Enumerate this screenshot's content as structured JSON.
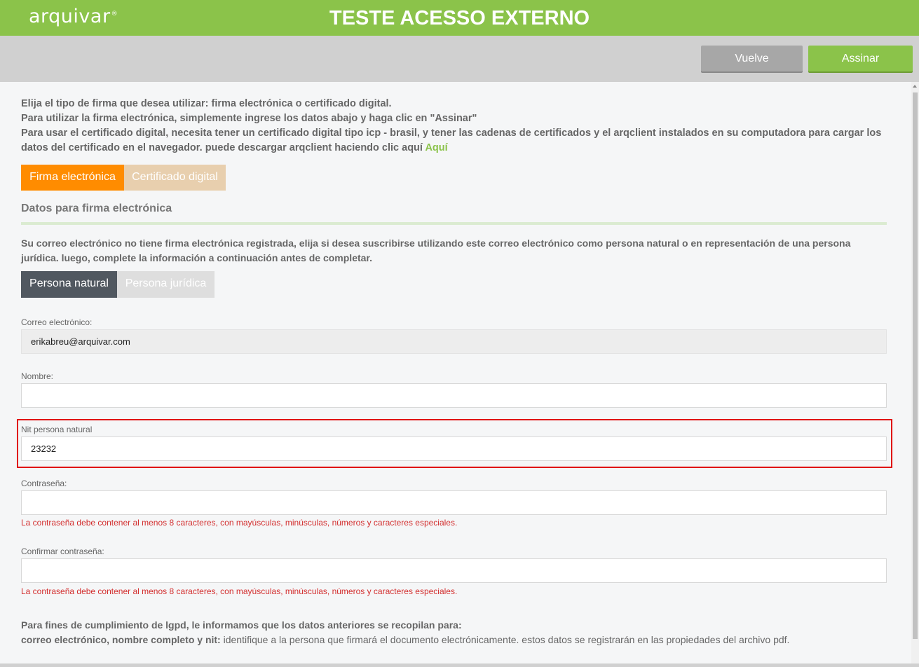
{
  "header": {
    "logo": "arquivar",
    "logo_mark": "®",
    "title": "TESTE ACESSO EXTERNO",
    "brand_color": "#8bc34a"
  },
  "toolbar": {
    "back_label": "Vuelve",
    "sign_label": "Assinar"
  },
  "intro": {
    "line1": "Elija el tipo de firma que desea utilizar: firma electrónica o certificado digital.",
    "line2": "Para utilizar la firma electrónica, simplemente ingrese los datos abajo y haga clic en \"Assinar\"",
    "line3": "Para usar el certificado digital, necesita tener un certificado digital tipo icp - brasil, y tener las cadenas de certificados y el arqclient instalados en su computadora para cargar los datos del certificado en el navegador. puede descargar arqclient haciendo clic aquí",
    "link": "Aquí"
  },
  "signature_tabs": {
    "electronic": "Firma electrónica",
    "certificate": "Certificado digital",
    "active": "electronic"
  },
  "section": {
    "title": "Datos para firma electrónica",
    "notice": "Su correo electrónico no tiene firma electrónica registrada, elija si desea suscribirse utilizando este correo electrónico como persona natural o en representación de una persona jurídica. luego, complete la información a continuación antes de completar."
  },
  "person_tabs": {
    "natural": "Persona natural",
    "juridica": "Persona jurídica",
    "active": "natural"
  },
  "form": {
    "email_label": "Correo electrónico:",
    "email_value": "erikabreu@arquivar.com",
    "name_label": "Nombre:",
    "name_value": "",
    "nit_label": "Nit persona natural",
    "nit_value": "23232",
    "password_label": "Contraseña:",
    "password_error": "La contraseña debe contener al menos 8 caracteres, con mayúsculas, minúsculas, números y caracteres especiales.",
    "confirm_label": "Confirmar contraseña:",
    "confirm_error": "La contraseña debe contener al menos 8 caracteres, con mayúsculas, minúsculas, números y caracteres especiales."
  },
  "footer": {
    "line1": "Para fines de cumplimiento de lgpd, le informamos que los datos anteriores se recopilan para:",
    "line2_bold": "correo electrónico, nombre completo y nit:",
    "line2_rest": " identifique a la persona que firmará el documento electrónicamente. estos datos se registrarán en las propiedades del archivo pdf."
  }
}
